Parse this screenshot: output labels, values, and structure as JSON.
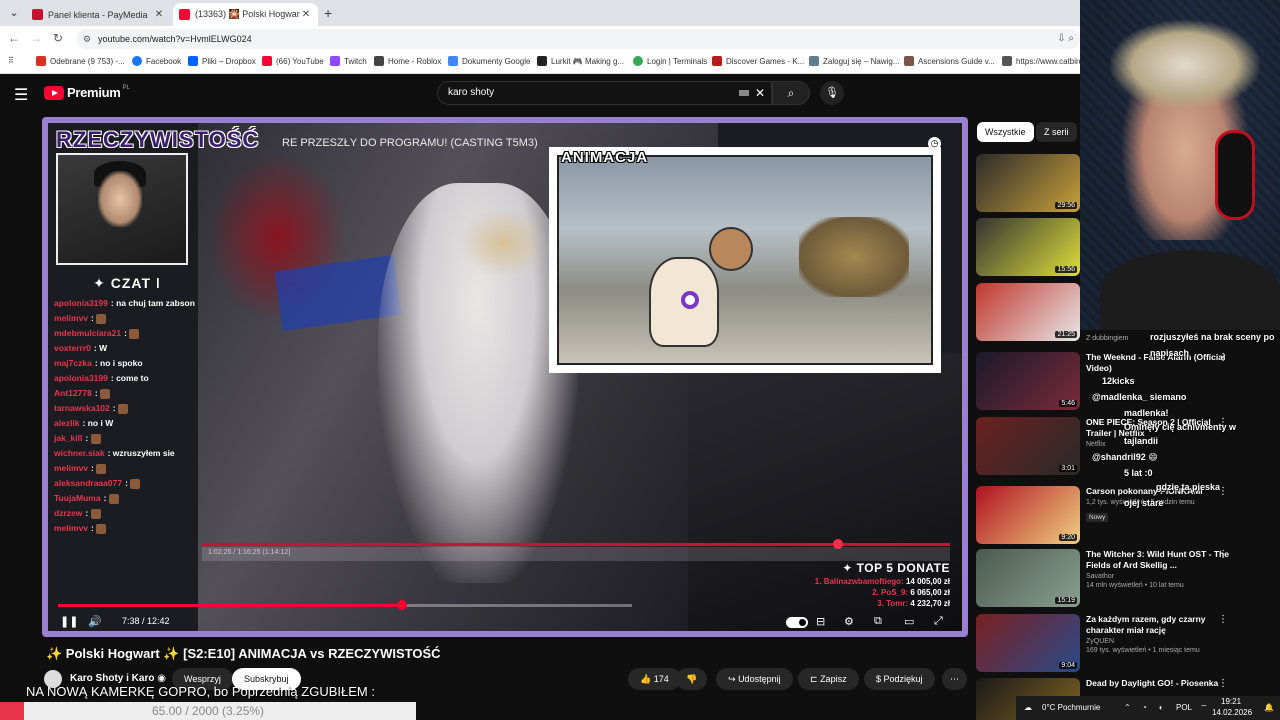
{
  "browser": {
    "tabs": [
      {
        "label": "Panel klienta - PayMedia",
        "color": "#c8102e"
      },
      {
        "label": "(13363) 🎇 Polski Hogwart ✨",
        "color": "#ff0033"
      }
    ],
    "url": "youtube.com/watch?v=HvmlELWG024",
    "bookmarks": [
      {
        "label": "Odebrane (9 753) -...",
        "color": "#d93025"
      },
      {
        "label": "Facebook",
        "color": "#1877f2"
      },
      {
        "label": "Pliki – Dropbox",
        "color": "#0061fe"
      },
      {
        "label": "(66) YouTube",
        "color": "#ff0033"
      },
      {
        "label": "Twitch",
        "color": "#9146ff"
      },
      {
        "label": "Home - Roblox",
        "color": "#444444"
      },
      {
        "label": "Dokumenty Google",
        "color": "#4285f4"
      },
      {
        "label": "Lurkit 🎮 Making g...",
        "color": "#222222"
      },
      {
        "label": "Login | Terminals",
        "color": "#34a853"
      },
      {
        "label": "Discover Games - K...",
        "color": "#b71c1c"
      },
      {
        "label": "Zaloguj się – Nawig...",
        "color": "#607d8b"
      },
      {
        "label": "Ascensions Guide v...",
        "color": "#795548"
      },
      {
        "label": "https://www.catbird...",
        "color": "#555555"
      }
    ]
  },
  "youtube": {
    "logo_text": "Premium",
    "country": "PL",
    "search_value": "karo shoty"
  },
  "video": {
    "overlay_logo": "RZECZYWISTOŚĆ",
    "overlay_title": "RE PRZESZŁY DO PROGRAMU! (CASTING T5M3)",
    "inset_label": "ANIMACJA",
    "chat_header": "✦ CZAT ǀ",
    "chat": [
      {
        "user": "apolonia3199",
        "msg": "na chuj tam zabson",
        "color": "#e8344a"
      },
      {
        "user": "melimvv",
        "msg": "",
        "color": "#e8344a",
        "emote": true
      },
      {
        "user": "mdebmulciara21",
        "msg": "",
        "color": "#e8344a",
        "emote": true
      },
      {
        "user": "voxterrr0",
        "msg": "W",
        "color": "#e8344a"
      },
      {
        "user": "maj7czka",
        "msg": "no i spoko",
        "color": "#e8344a"
      },
      {
        "user": "apolonia3199",
        "msg": "come to",
        "color": "#e8344a"
      },
      {
        "user": "Ant12778",
        "msg": "",
        "color": "#e8344a",
        "emote": true
      },
      {
        "user": "tarnawska102",
        "msg": "",
        "color": "#e8344a",
        "emote": true
      },
      {
        "user": "alezlik",
        "msg": "no i W",
        "color": "#e8344a"
      },
      {
        "user": "jak_kill",
        "msg": "",
        "color": "#e8344a",
        "emote": true
      },
      {
        "user": "wichner.siak",
        "msg": "wzruszyłem sie",
        "color": "#e8344a"
      },
      {
        "user": "melimvv",
        "msg": "",
        "color": "#e8344a",
        "emote": true
      },
      {
        "user": "aleksandraaa077",
        "msg": "",
        "color": "#e8344a",
        "emote": true
      },
      {
        "user": "TuujaMuma",
        "msg": "",
        "color": "#e8344a",
        "emote": true
      },
      {
        "user": "dzrzew",
        "msg": "",
        "color": "#e8344a",
        "emote": true
      },
      {
        "user": "melimvv",
        "msg": "",
        "color": "#e8344a",
        "emote": true
      }
    ],
    "inner_player_time": "1:02:25 / 1:16:25 (1:14:12)",
    "donate_title": "✦ TOP 5 DONATE",
    "donates": [
      {
        "rank": "1.",
        "name": "Balinazwbamoftiego",
        "amount": "14 005,00 zł"
      },
      {
        "rank": "2.",
        "name": "PoS_9",
        "amount": "6 065,00 zł"
      },
      {
        "rank": "3.",
        "name": "Tomr",
        "amount": "4 232,70 zł"
      }
    ],
    "time": "7:38 / 12:42",
    "progress_fraction": 0.6
  },
  "below": {
    "title": "✨ Polski Hogwart ✨ [S2:E10] ANIMACJA vs RZECZYWISTOŚĆ",
    "channel": "Karo Shoty i Karo",
    "support_label": "Wesprzyj",
    "subscribe_label": "Subskrybuj",
    "likes": "174",
    "share_label": "Udostępnij",
    "save_label": "Zapisz",
    "thanks_label": "Podziękuj",
    "overlay_text": "NA NOWĄ KAMERKĘ GOPRO, bo Poprzednią ZGUBIŁEM :",
    "counter": "65.00 / 2000 (3.25%)"
  },
  "sidebar": {
    "chips": [
      "Wszystkie",
      "Z serii"
    ],
    "recs": [
      {
        "title": "",
        "meta": "",
        "duration": "29:56",
        "color1": "#2b2b2b",
        "color2": "#c9a03a"
      },
      {
        "title": "",
        "meta": "",
        "duration": "15:56",
        "color1": "#333333",
        "color2": "#dede3a"
      },
      {
        "title": "",
        "meta": "Z dubbingiem",
        "duration": "21:25",
        "color1": "#c0362c",
        "color2": "#e8e8e8"
      },
      {
        "title": "The Weeknd - False Alarm (Official Video)",
        "meta": "",
        "duration": "5:46",
        "color1": "#1a1a2a",
        "color2": "#7a2a3a"
      },
      {
        "title": "ONE PIECE: Season 2 | Official Trailer | Netflix",
        "meta": "Netflix",
        "duration": "3:01",
        "color1": "#6b2020",
        "color2": "#2a2a2a"
      },
      {
        "title": "Carson pokonany PIONKAMI",
        "meta": "1,2 tys. wyświetleń • 5 godzin temu",
        "duration": "9:20",
        "color1": "#b01020",
        "color2": "#f0d080",
        "badge": "Nowy"
      },
      {
        "title": "The Witcher 3: Wild Hunt OST - The Fields of Ard Skellig ...",
        "meta": "Savathor",
        "meta2": "14 mln wyświetleń • 10 lat temu",
        "duration": "15:19",
        "color1": "#4a5a50",
        "color2": "#8aa090"
      },
      {
        "title": "Za każdym razem, gdy czarny charakter miał rację",
        "meta": "ZyQUEN",
        "meta2": "169 tys. wyświetleń • 1 miesiąc temu",
        "duration": "9:04",
        "color1": "#7a2020",
        "color2": "#2a4a8a"
      },
      {
        "title": "Dead by Daylight GO! - Piosenka",
        "meta": "",
        "duration": "",
        "color1": "#1a1a1a",
        "color2": "#8a6a20"
      }
    ]
  },
  "stream_chat": [
    {
      "text": "rozjuszyłeś na brak sceny po"
    },
    {
      "text": "napisach"
    },
    {
      "text": "12kicks"
    },
    {
      "text": "@madlenka_ siemano"
    },
    {
      "text": "madlenka!"
    },
    {
      "text": "Ominęły cię achivmenty w"
    },
    {
      "text": "tajlandii"
    },
    {
      "text": "@shandril92 😄"
    },
    {
      "text": "5 lat :0"
    },
    {
      "text": "gdzie ta pieska"
    },
    {
      "text": "ojej stare"
    }
  ],
  "taskbar": {
    "weather": "0°C Pochmurnie",
    "lang": "POL",
    "time": "19:21",
    "date": "14.02.2026"
  }
}
